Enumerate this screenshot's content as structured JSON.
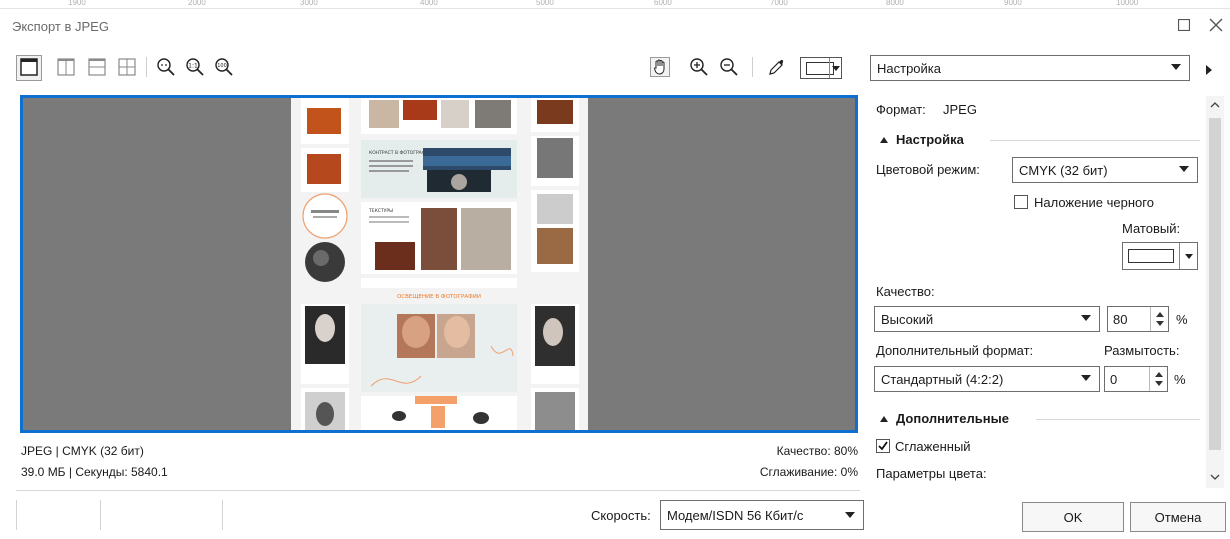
{
  "window": {
    "title": "Экспорт в JPEG"
  },
  "ruler": {
    "ticks": [
      "1900",
      "2000",
      "3000",
      "4000",
      "5000",
      "6000",
      "7000",
      "8000",
      "9000",
      "10000"
    ]
  },
  "toolbar": {
    "preset_dropdown": "Настройка"
  },
  "status": {
    "left_line1": "JPEG  |  CMYK (32 бит)",
    "left_line2": "39.0 МБ  |  Секунды: 5840.1",
    "quality": "Качество: 80%",
    "smoothing": "Сглаживание: 0%"
  },
  "preview_page": {
    "heading1": "КОНТРАСТ В ФОТОГРАФИИ",
    "heading2": "ТЕКСТУРЫ",
    "heading3": "ОСВЕЩЕНИЕ В ФОТОГРАФИИ"
  },
  "panel": {
    "format_label": "Формат:",
    "format_value": "JPEG",
    "settings_section": "Настройка",
    "color_mode_label": "Цветовой режим:",
    "color_mode_value": "CMYK (32 бит)",
    "overprint_black": "Наложение черного",
    "matte_label": "Матовый:",
    "quality_label": "Качество:",
    "quality_value": "Высокий",
    "quality_number": "80",
    "percent": "%",
    "extra_format_label": "Дополнительный формат:",
    "blur_label": "Размытость:",
    "extra_format_value": "Стандартный (4:2:2)",
    "blur_number": "0",
    "advanced_section": "Дополнительные",
    "antialiased": "Сглаженный",
    "color_params": "Параметры цвета:"
  },
  "speed": {
    "label": "Скорость:",
    "value": "Модем/ISDN 56 Кбит/с"
  },
  "buttons": {
    "ok": "OK",
    "cancel": "Отмена"
  },
  "colors": {
    "accent": "#0f6fd1",
    "preview_bg": "#7a7a7a",
    "orange": "#f07a2a"
  }
}
